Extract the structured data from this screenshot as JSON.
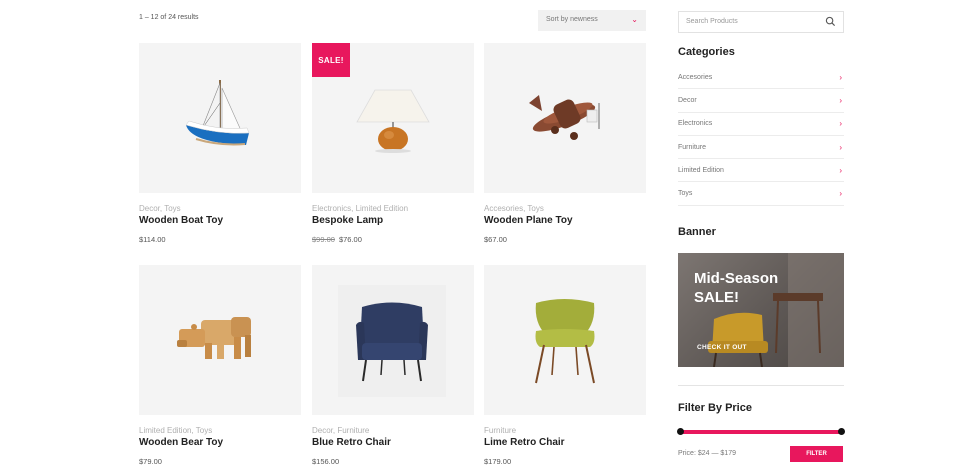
{
  "toolbar": {
    "results_text": "1 – 12 of 24 results",
    "sort_label": "Sort by newness"
  },
  "products": [
    {
      "categories": "Decor, Toys",
      "name": "Wooden Boat Toy",
      "price": "$114.00",
      "old_price": "",
      "sale": false,
      "image_icon": "boat-toy"
    },
    {
      "categories": "Electronics, Limited Edition",
      "name": "Bespoke Lamp",
      "price": "$76.00",
      "old_price": "$99.00",
      "sale": true,
      "image_icon": "table-lamp"
    },
    {
      "categories": "Accesories, Toys",
      "name": "Wooden Plane Toy",
      "price": "$67.00",
      "old_price": "",
      "sale": false,
      "image_icon": "plane-toy"
    },
    {
      "categories": "Limited Edition, Toys",
      "name": "Wooden Bear Toy",
      "price": "$79.00",
      "old_price": "",
      "sale": false,
      "image_icon": "bear-toy"
    },
    {
      "categories": "Decor, Furniture",
      "name": "Blue Retro Chair",
      "price": "$156.00",
      "old_price": "",
      "sale": false,
      "image_icon": "armchair"
    },
    {
      "categories": "Furniture",
      "name": "Lime Retro Chair",
      "price": "$179.00",
      "old_price": "",
      "sale": false,
      "image_icon": "chair"
    }
  ],
  "sale_badge": "SALE!",
  "sidebar": {
    "search_placeholder": "Search Products",
    "categories_title": "Categories",
    "categories": [
      "Accesories",
      "Decor",
      "Electronics",
      "Furniture",
      "Limited Edition",
      "Toys"
    ],
    "banner_title": "Banner",
    "banner_line1": "Mid-Season",
    "banner_line2": "SALE!",
    "banner_cta": "CHECK IT OUT",
    "filter_title": "Filter By Price",
    "price_range": "Price: $24 — $179",
    "filter_button": "FILTER"
  },
  "colors": {
    "accent": "#e8175d",
    "tile_bg": "#f4f4f4"
  }
}
